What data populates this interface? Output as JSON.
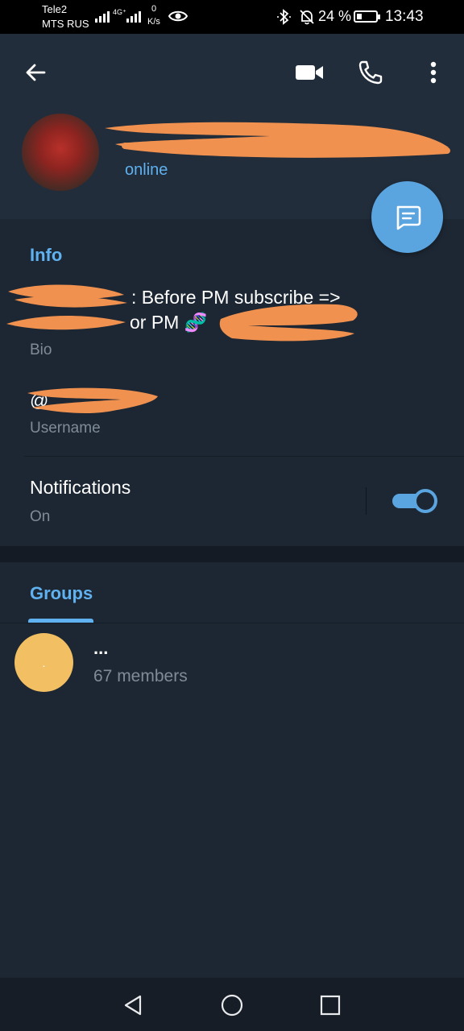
{
  "status_bar": {
    "carrier_1": "Tele2",
    "carrier_2": "MTS RUS",
    "network_tag": "4G⁺",
    "speed_value": "0",
    "speed_unit": "K/s",
    "battery_percent": "24 %",
    "battery_level": 0.24,
    "time": "13:43",
    "icons": [
      "signal-icon",
      "eye-icon",
      "bluetooth-icon",
      "bell-off-icon",
      "battery-icon"
    ]
  },
  "header": {
    "status": "online",
    "icons": [
      "back-arrow-icon",
      "video-call-icon",
      "phone-icon",
      "more-vert-icon",
      "message-icon"
    ]
  },
  "info": {
    "section_title": "Info",
    "bio_line_1": ": Before PM subscribe =>",
    "bio_line_2": "or PM 🧬",
    "bio_label": "Bio",
    "username_value": "@",
    "username_label": "Username",
    "notifications_title": "Notifications",
    "notifications_state": "On",
    "notifications_enabled": true
  },
  "groups": {
    "tab_label": "Groups",
    "items": [
      {
        "name": "...",
        "members": "67 members",
        "avatar_letter": "."
      }
    ]
  },
  "nav": {
    "icons": [
      "back-triangle-icon",
      "home-circle-icon",
      "recents-square-icon"
    ]
  },
  "colors": {
    "accent": "#5fb1ef",
    "fab": "#5aa4e0",
    "background": "#1d2733",
    "header": "#212d3b",
    "group_avatar": "#f2bf63",
    "redaction": "#f0914f"
  }
}
